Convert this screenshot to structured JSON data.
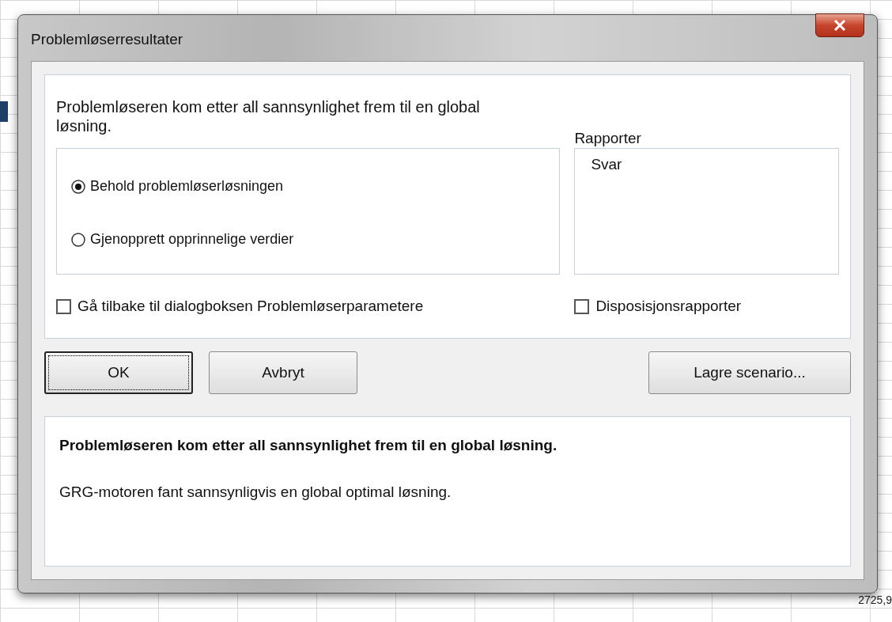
{
  "window": {
    "title": "Problemløserresultater"
  },
  "message": "Problemløseren kom etter all sannsynlighet frem til en global løsning.",
  "options": [
    {
      "label": "Behold problemløserløsningen",
      "selected": true
    },
    {
      "label": "Gjenopprett opprinnelige verdier",
      "selected": false
    }
  ],
  "reports": {
    "label": "Rapporter",
    "items": [
      {
        "label": "Svar",
        "selected": false
      }
    ]
  },
  "checkboxes": [
    {
      "label": "Gå tilbake til dialogboksen Problemløserparametere",
      "checked": false
    },
    {
      "label": "Disposisjonsrapporter",
      "checked": false
    }
  ],
  "buttons": [
    {
      "label": "OK",
      "default": true
    },
    {
      "label": "Avbryt",
      "default": false
    },
    {
      "label": "Lagre scenario...",
      "default": false
    }
  ],
  "details": {
    "heading": "Problemløseren kom etter all sannsynlighet frem til en global løsning.",
    "text": "GRG-motoren fant sannsynligvis en global optimal løsning."
  },
  "background_cells": [
    "2725,9"
  ]
}
